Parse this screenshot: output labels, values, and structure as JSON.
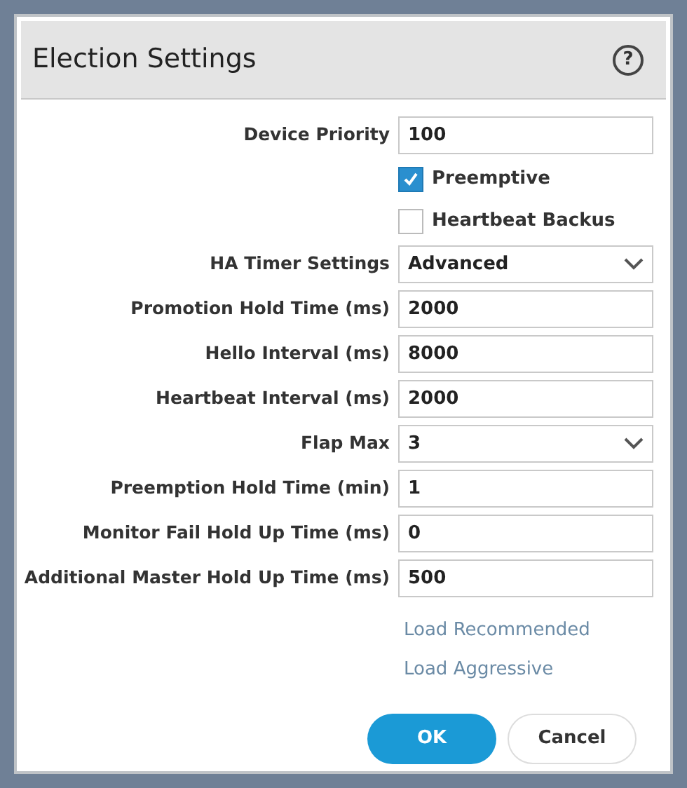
{
  "dialog": {
    "title": "Election Settings",
    "help_icon": "?"
  },
  "rows": [
    {
      "kind": "text",
      "label": "Device Priority",
      "value": "100"
    },
    {
      "kind": "checkbox",
      "label": "Preemptive",
      "checked": true
    },
    {
      "kind": "checkbox",
      "label": "Heartbeat Backus",
      "checked": false
    },
    {
      "kind": "select",
      "label": "HA Timer Settings",
      "value": "Advanced"
    },
    {
      "kind": "text",
      "label": "Promotion Hold Time (ms)",
      "value": "2000"
    },
    {
      "kind": "text",
      "label": "Hello Interval (ms)",
      "value": "8000"
    },
    {
      "kind": "text",
      "label": "Heartbeat Interval (ms)",
      "value": "2000"
    },
    {
      "kind": "select",
      "label": "Flap Max",
      "value": "3"
    },
    {
      "kind": "text",
      "label": "Preemption Hold Time (min)",
      "value": "1"
    },
    {
      "kind": "text",
      "label": "Monitor Fail Hold Up Time (ms)",
      "value": "0"
    },
    {
      "kind": "text",
      "label": "Additional Master Hold Up Time (ms)",
      "value": "500"
    }
  ],
  "links": [
    "Load Recommended",
    "Load Aggressive"
  ],
  "buttons": [
    {
      "kind": "primary",
      "label": "OK"
    },
    {
      "kind": "secondary",
      "label": "Cancel"
    }
  ]
}
